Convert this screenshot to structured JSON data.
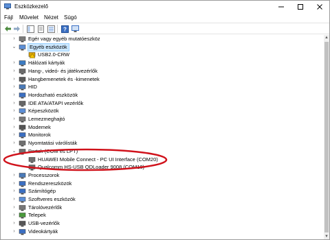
{
  "window": {
    "title": "Eszközkezelő"
  },
  "menu": [
    "Fájl",
    "Művelet",
    "Nézet",
    "Súgó"
  ],
  "tree": [
    {
      "label": "Egér vagy egyéb mutatóeszköz",
      "level": 1,
      "expanded": false,
      "icon": "mouse-icon"
    },
    {
      "label": "Egyéb eszközök",
      "level": 1,
      "expanded": true,
      "icon": "unknown-device-icon",
      "selected": true
    },
    {
      "label": "USB2.0-CRW",
      "level": 2,
      "icon": "warning-device-icon"
    },
    {
      "label": "Hálózati kártyák",
      "level": 1,
      "expanded": false,
      "icon": "network-icon"
    },
    {
      "label": "Hang-, videó- és játékvezérlők",
      "level": 1,
      "expanded": false,
      "icon": "sound-icon"
    },
    {
      "label": "Hangbemenetek és -kimenetek",
      "level": 1,
      "expanded": false,
      "icon": "audio-io-icon"
    },
    {
      "label": "HID",
      "level": 1,
      "expanded": false,
      "icon": "hid-icon"
    },
    {
      "label": "Hordozható eszközök",
      "level": 1,
      "expanded": false,
      "icon": "portable-device-icon"
    },
    {
      "label": "IDE ATA/ATAPI vezérlők",
      "level": 1,
      "expanded": false,
      "icon": "ide-icon"
    },
    {
      "label": "Képeszközök",
      "level": 1,
      "expanded": false,
      "icon": "camera-icon"
    },
    {
      "label": "Lemezmeghajtó",
      "level": 1,
      "expanded": false,
      "icon": "disk-icon"
    },
    {
      "label": "Modemek",
      "level": 1,
      "expanded": false,
      "icon": "modem-icon"
    },
    {
      "label": "Monitorok",
      "level": 1,
      "expanded": false,
      "icon": "monitor-icon"
    },
    {
      "label": "Nyomtatási várólisták",
      "level": 1,
      "expanded": false,
      "icon": "printer-icon"
    },
    {
      "label": "Portok (COM és LPT)",
      "level": 1,
      "expanded": true,
      "icon": "port-icon"
    },
    {
      "label": "HUAWEI Mobile Connect - PC UI Interface (COM20)",
      "level": 2,
      "icon": "port-device-icon"
    },
    {
      "label": "Qualcomm HS-USB QDLoader 9008 (COM10)",
      "level": 2,
      "icon": "port-device-icon"
    },
    {
      "label": "Processzorok",
      "level": 1,
      "expanded": false,
      "icon": "cpu-icon"
    },
    {
      "label": "Rendszereszközök",
      "level": 1,
      "expanded": false,
      "icon": "system-icon"
    },
    {
      "label": "Számítógép",
      "level": 1,
      "expanded": false,
      "icon": "computer-icon"
    },
    {
      "label": "Szoftveres eszközök",
      "level": 1,
      "expanded": false,
      "icon": "software-icon"
    },
    {
      "label": "Tárolóvezérlők",
      "level": 1,
      "expanded": false,
      "icon": "storage-icon"
    },
    {
      "label": "Telepek",
      "level": 1,
      "expanded": false,
      "icon": "battery-icon"
    },
    {
      "label": "USB-vezérlők",
      "level": 1,
      "expanded": false,
      "icon": "usb-icon"
    },
    {
      "label": "Videokártyák",
      "level": 1,
      "expanded": false,
      "icon": "display-adapter-icon"
    }
  ],
  "colors": {
    "annotation": "#d0121b",
    "selection": "#cce8ff"
  }
}
